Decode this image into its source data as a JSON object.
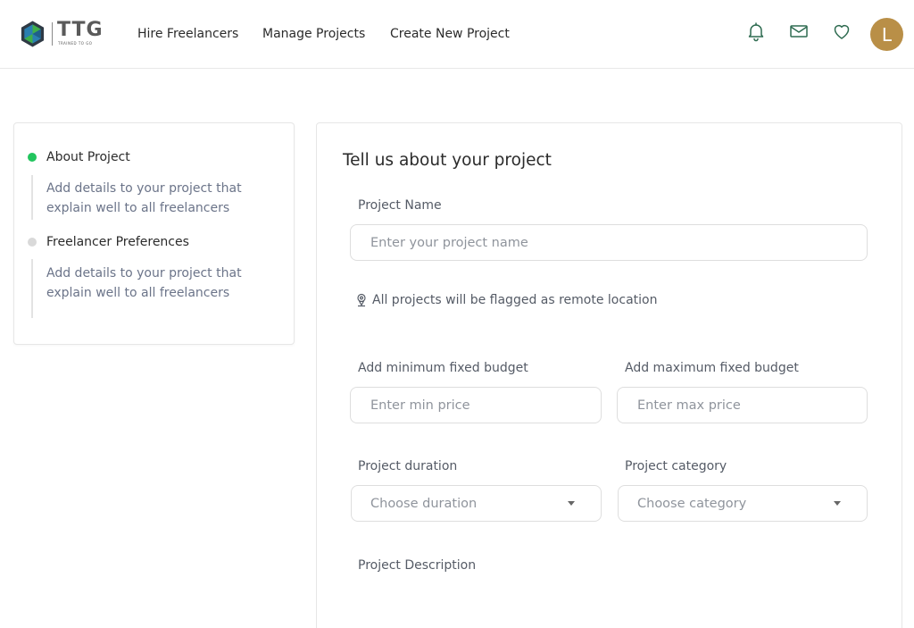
{
  "header": {
    "logo_text": "TTG",
    "logo_subtext": "TRAINED TO GO",
    "nav": [
      "Hire Freelancers",
      "Manage Projects",
      "Create New Project"
    ],
    "icons": [
      "bell-icon",
      "mail-icon",
      "heart-icon"
    ],
    "avatar_initial": "L",
    "avatar_color": "#b98f47"
  },
  "steps": [
    {
      "title": "About Project",
      "description": "Add details to your project that explain well to all freelancers",
      "status": "active",
      "dot_color": "#22c55e"
    },
    {
      "title": "Freelancer Preferences",
      "description": "Add details to your project that explain well to all freelancers",
      "status": "inactive",
      "dot_color": "#d9d9d9"
    }
  ],
  "form": {
    "title": "Tell us about your project",
    "project_name": {
      "label": "Project Name",
      "placeholder": "Enter your project name",
      "value": ""
    },
    "remote_note": "All projects will be flagged as remote location",
    "min_budget": {
      "label": "Add minimum fixed budget",
      "placeholder": "Enter min price",
      "value": ""
    },
    "max_budget": {
      "label": "Add maximum fixed budget",
      "placeholder": "Enter max price",
      "value": ""
    },
    "duration": {
      "label": "Project duration",
      "selected": "Choose duration"
    },
    "category": {
      "label": "Project category",
      "selected": "Choose category"
    },
    "description": {
      "label": "Project Description"
    }
  }
}
